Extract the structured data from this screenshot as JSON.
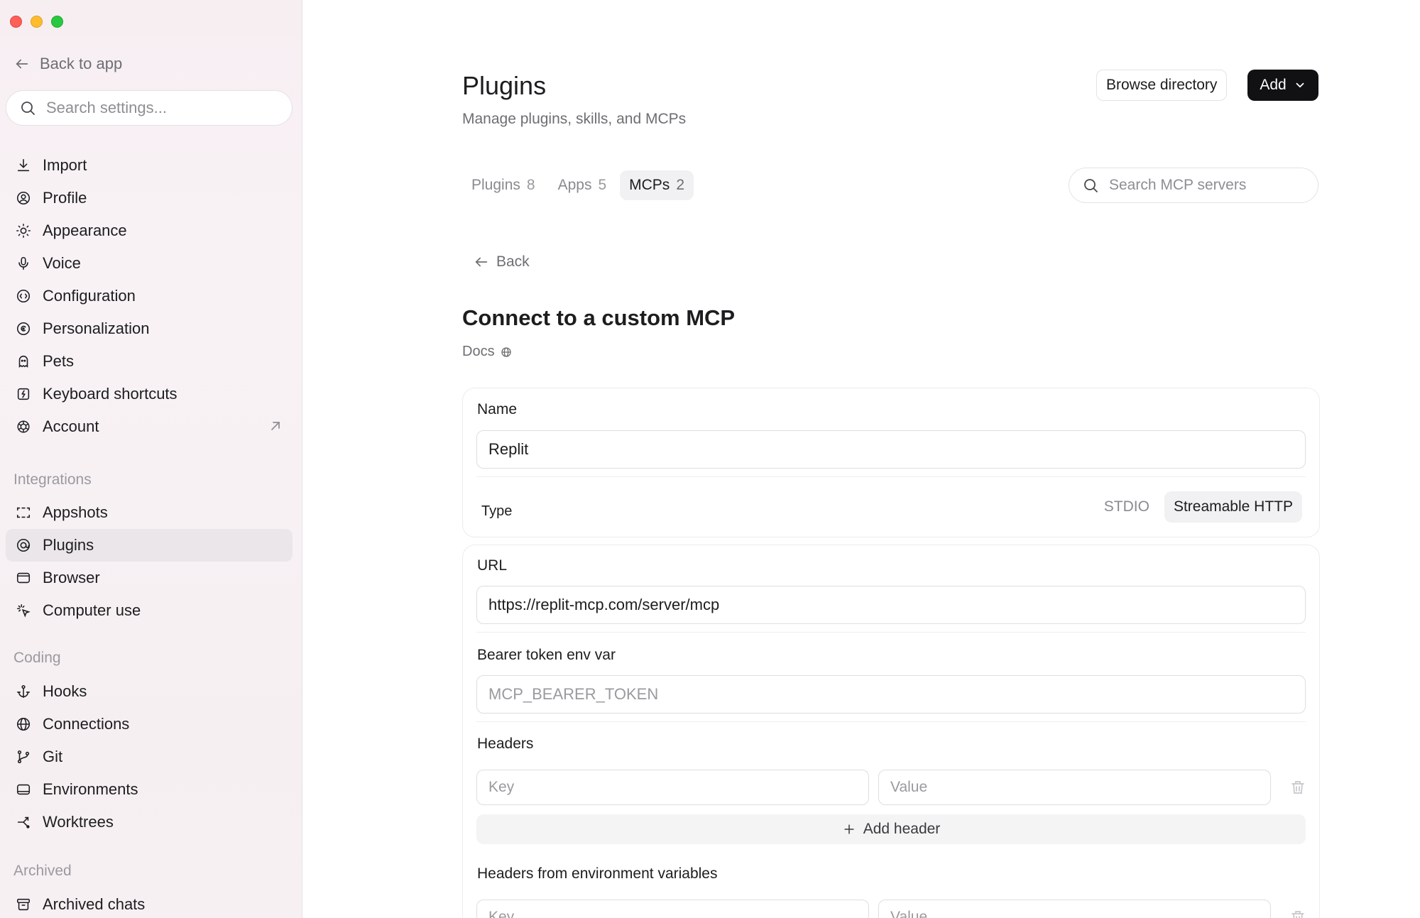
{
  "sidebar": {
    "back_label": "Back to app",
    "search_placeholder": "Search settings...",
    "general_items": [
      {
        "label": "Import",
        "icon": "download-icon"
      },
      {
        "label": "Profile",
        "icon": "user-circle-icon"
      },
      {
        "label": "Appearance",
        "icon": "sun-icon"
      },
      {
        "label": "Voice",
        "icon": "microphone-icon"
      },
      {
        "label": "Configuration",
        "icon": "config-icon"
      },
      {
        "label": "Personalization",
        "icon": "personalization-icon"
      },
      {
        "label": "Pets",
        "icon": "pet-icon"
      },
      {
        "label": "Keyboard shortcuts",
        "icon": "keyboard-icon"
      },
      {
        "label": "Account",
        "icon": "openai-logo-icon"
      }
    ],
    "integrations_label": "Integrations",
    "integration_items": [
      {
        "label": "Appshots",
        "icon": "appshots-icon"
      },
      {
        "label": "Plugins",
        "icon": "plugins-icon"
      },
      {
        "label": "Browser",
        "icon": "browser-icon"
      },
      {
        "label": "Computer use",
        "icon": "cursor-click-icon"
      }
    ],
    "coding_label": "Coding",
    "coding_items": [
      {
        "label": "Hooks",
        "icon": "anchor-icon"
      },
      {
        "label": "Connections",
        "icon": "globe-icon"
      },
      {
        "label": "Git",
        "icon": "git-branch-icon"
      },
      {
        "label": "Environments",
        "icon": "environment-icon"
      },
      {
        "label": "Worktrees",
        "icon": "worktree-icon"
      }
    ],
    "archived_label": "Archived",
    "archived_items": [
      {
        "label": "Archived chats",
        "icon": "archive-icon"
      }
    ]
  },
  "header": {
    "title": "Plugins",
    "subtitle": "Manage plugins, skills, and MCPs",
    "browse_label": "Browse directory",
    "add_label": "Add"
  },
  "tabs": [
    {
      "label": "Plugins",
      "count": "8"
    },
    {
      "label": "Apps",
      "count": "5"
    },
    {
      "label": "MCPs",
      "count": "2"
    }
  ],
  "search_mcp_placeholder": "Search MCP servers",
  "back_label": "Back",
  "form": {
    "title": "Connect to a custom MCP",
    "docs_label": "Docs",
    "name_label": "Name",
    "name_value": "Replit",
    "type_label": "Type",
    "type_options": [
      "STDIO",
      "Streamable HTTP"
    ],
    "url_label": "URL",
    "url_value": "https://replit-mcp.com/server/mcp",
    "bearer_label": "Bearer token env var",
    "bearer_placeholder": "MCP_BEARER_TOKEN",
    "headers_label": "Headers",
    "key_placeholder": "Key",
    "value_placeholder": "Value",
    "add_header_label": "Add header",
    "env_headers_label": "Headers from environment variables"
  }
}
